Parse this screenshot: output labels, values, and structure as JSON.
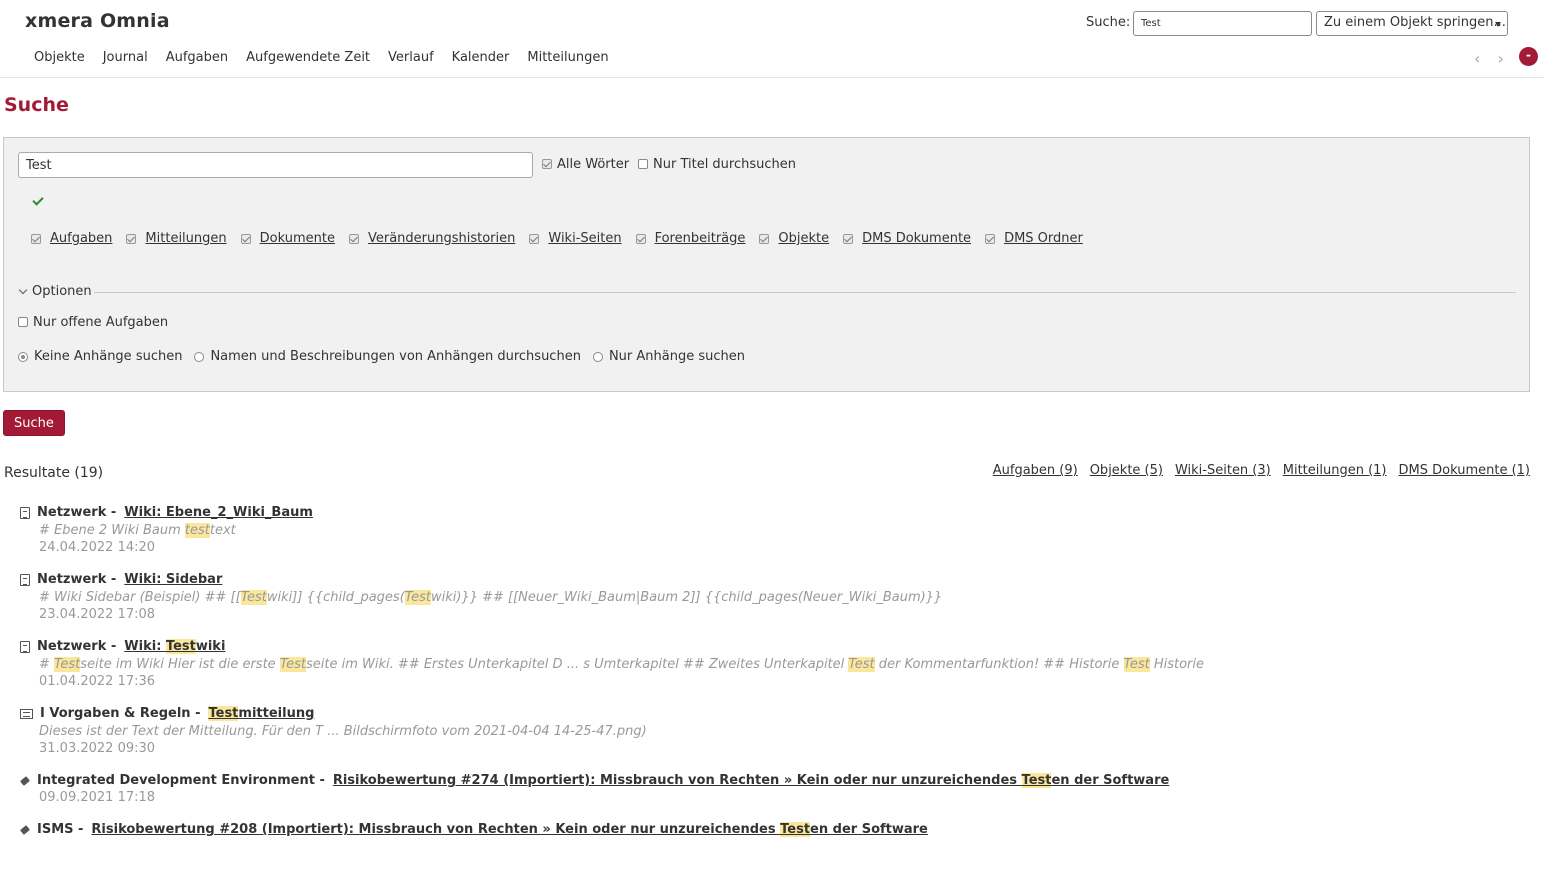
{
  "header": {
    "app_title": "xmera Omnia",
    "quick_search_label": "Suche:",
    "quick_search_value": "Test",
    "jump_select_label": "Zu einem Objekt springen...",
    "menu": [
      "Objekte",
      "Journal",
      "Aufgaben",
      "Aufgewendete Zeit",
      "Verlauf",
      "Kalender",
      "Mitteilungen"
    ],
    "nav_arrows": "‹ ›",
    "avatar_text": "-"
  },
  "page_title": "Suche",
  "search": {
    "query": "Test",
    "all_words_label": "Alle Wörter",
    "all_words_checked": true,
    "titles_only_label": "Nur Titel durchsuchen",
    "titles_only_checked": false,
    "scopes": [
      {
        "label": "Aufgaben",
        "checked": true
      },
      {
        "label": "Mitteilungen",
        "checked": true
      },
      {
        "label": "Dokumente",
        "checked": true
      },
      {
        "label": "Veränderungshistorien",
        "checked": true
      },
      {
        "label": "Wiki-Seiten",
        "checked": true
      },
      {
        "label": "Forenbeiträge",
        "checked": true
      },
      {
        "label": "Objekte",
        "checked": true
      },
      {
        "label": "DMS Dokumente",
        "checked": true
      },
      {
        "label": "DMS Ordner",
        "checked": true
      }
    ],
    "options_legend": "Optionen",
    "open_issues_label": "Nur offene Aufgaben",
    "open_issues_checked": false,
    "attachments": [
      {
        "label": "Keine Anhänge suchen",
        "checked": true
      },
      {
        "label": "Namen und Beschreibungen von Anhängen durchsuchen",
        "checked": false
      },
      {
        "label": "Nur Anhänge suchen",
        "checked": false
      }
    ],
    "submit_label": "Suche"
  },
  "results": {
    "heading": "Resultate (19)",
    "filters": [
      "Aufgaben (9)",
      "Objekte (5)",
      "Wiki-Seiten (3)",
      "Mitteilungen (1)",
      "DMS Dokumente (1)"
    ],
    "items": [
      {
        "icon": "wiki-page-icon",
        "project": "Netzwerk -",
        "title_parts": [
          {
            "t": "Wiki: Ebene_2_Wiki_Baum",
            "h": false
          }
        ],
        "desc_parts": [
          {
            "t": "# Ebene 2 Wiki Baum ",
            "h": false
          },
          {
            "t": "test",
            "h": true
          },
          {
            "t": "text",
            "h": false
          }
        ],
        "date": "24.04.2022 14:20"
      },
      {
        "icon": "wiki-page-icon",
        "project": "Netzwerk -",
        "title_parts": [
          {
            "t": "Wiki: Sidebar",
            "h": false
          }
        ],
        "desc_parts": [
          {
            "t": "# Wiki Sidebar (Beispiel) ## [[",
            "h": false
          },
          {
            "t": "Test",
            "h": true
          },
          {
            "t": "wiki]] {{child_pages(",
            "h": false
          },
          {
            "t": "Test",
            "h": true
          },
          {
            "t": "wiki)}} ## [[Neuer_Wiki_Baum|Baum 2]] {{child_pages(Neuer_Wiki_Baum)}}",
            "h": false
          }
        ],
        "date": "23.04.2022 17:08"
      },
      {
        "icon": "wiki-page-icon",
        "project": "Netzwerk -",
        "title_parts": [
          {
            "t": "Wiki: ",
            "h": false
          },
          {
            "t": "Test",
            "h": true
          },
          {
            "t": "wiki",
            "h": false
          }
        ],
        "desc_parts": [
          {
            "t": "# ",
            "h": false
          },
          {
            "t": "Test",
            "h": true
          },
          {
            "t": "seite im Wiki Hier ist die erste ",
            "h": false
          },
          {
            "t": "Test",
            "h": true
          },
          {
            "t": "seite im Wiki. ## Erstes Unterkapitel D ... s Umterkapitel ## Zweites Unterkapitel ",
            "h": false
          },
          {
            "t": "Test",
            "h": true
          },
          {
            "t": " der Kommentarfunktion! ## Historie ",
            "h": false
          },
          {
            "t": "Test",
            "h": true
          },
          {
            "t": " Historie",
            "h": false
          }
        ],
        "date": "01.04.2022 17:36"
      },
      {
        "icon": "news-icon",
        "project": "I Vorgaben & Regeln -",
        "title_parts": [
          {
            "t": "Test",
            "h": true
          },
          {
            "t": "mitteilung",
            "h": false
          }
        ],
        "desc_parts": [
          {
            "t": "Dieses ist der Text der Mitteilung. Für den T ... Bildschirmfoto vom 2021-04-04 14-25-47.png)",
            "h": false
          }
        ],
        "date": "31.03.2022 09:30"
      },
      {
        "icon": "issue-icon",
        "project": "Integrated Development Environment -",
        "title_parts": [
          {
            "t": "Risikobewertung #274 (Importiert): Missbrauch von Rechten » Kein oder nur unzureichendes ",
            "h": false
          },
          {
            "t": "Test",
            "h": true
          },
          {
            "t": "en der Software",
            "h": false
          }
        ],
        "desc_parts": [],
        "date": "09.09.2021 17:18"
      },
      {
        "icon": "issue-icon",
        "project": "ISMS -",
        "title_parts": [
          {
            "t": "Risikobewertung #208 (Importiert): Missbrauch von Rechten » Kein oder nur unzureichendes ",
            "h": false
          },
          {
            "t": "Test",
            "h": true
          },
          {
            "t": "en der Software",
            "h": false
          }
        ],
        "desc_parts": [],
        "date": ""
      }
    ]
  }
}
